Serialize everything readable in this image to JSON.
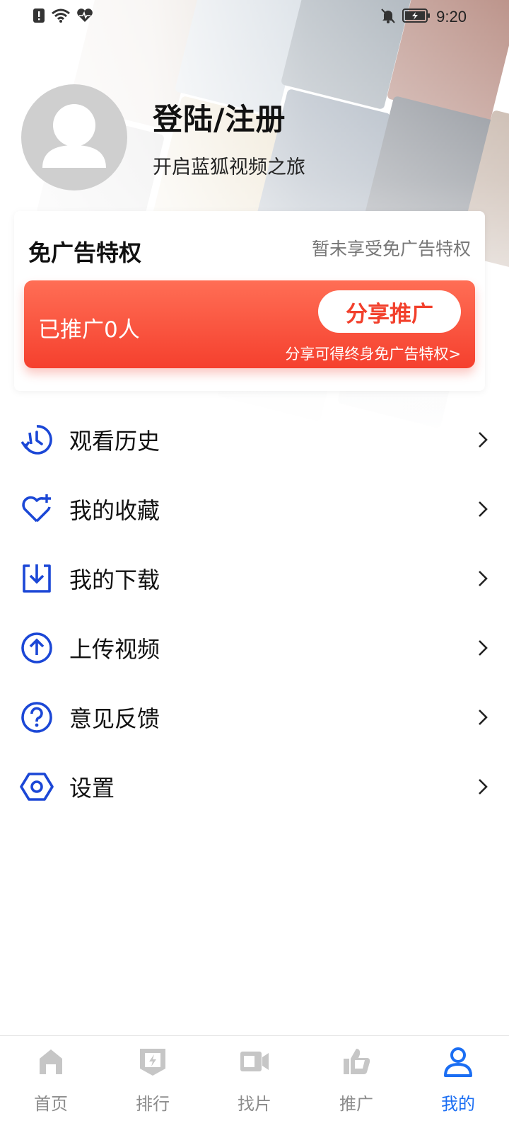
{
  "status_bar": {
    "time": "9:20",
    "icons_left": [
      "alert-icon",
      "wifi-icon",
      "heart-monitor-icon"
    ],
    "icons_right": [
      "bell-off-icon",
      "battery-icon"
    ]
  },
  "profile": {
    "login_title": "登陆/注册",
    "subtitle": "开启蓝狐视频之旅"
  },
  "adfree": {
    "title": "免广告特权",
    "status": "暂未享受免广告特权",
    "promo_count": "已推广0人",
    "share_button": "分享推广",
    "hint": "分享可得终身免广告特权>"
  },
  "menu": {
    "items": [
      {
        "label": "观看历史",
        "icon": "history-icon"
      },
      {
        "label": "我的收藏",
        "icon": "favorite-heart-icon"
      },
      {
        "label": "我的下载",
        "icon": "download-icon"
      },
      {
        "label": "上传视频",
        "icon": "upload-icon"
      },
      {
        "label": "意见反馈",
        "icon": "question-icon"
      },
      {
        "label": "设置",
        "icon": "settings-hex-icon"
      }
    ]
  },
  "bottom_nav": {
    "items": [
      {
        "label": "首页",
        "icon": "home-icon"
      },
      {
        "label": "排行",
        "icon": "ranking-icon"
      },
      {
        "label": "找片",
        "icon": "video-camera-icon"
      },
      {
        "label": "推广",
        "icon": "thumbs-up-icon"
      },
      {
        "label": "我的",
        "icon": "person-icon"
      }
    ],
    "active_index": 4
  },
  "colors": {
    "accent_blue": "#1b47d6",
    "nav_active": "#1b6ef3",
    "promo_red": "#f5402e",
    "nav_inactive": "#c6c6c6"
  }
}
